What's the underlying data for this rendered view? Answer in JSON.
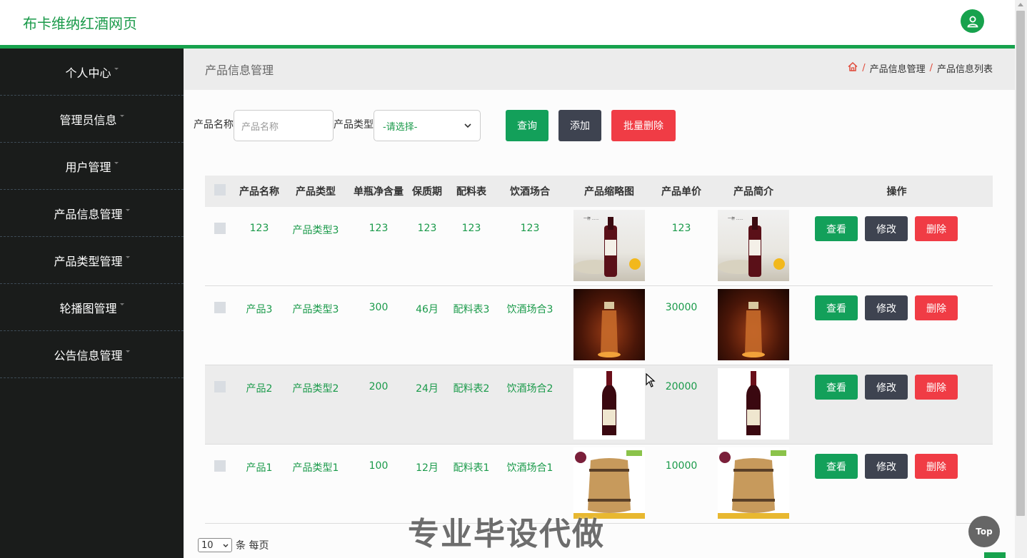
{
  "app": {
    "title": "布卡维纳红酒网页"
  },
  "sidebar": {
    "items": [
      {
        "label": "个人中心"
      },
      {
        "label": "管理员信息"
      },
      {
        "label": "用户管理"
      },
      {
        "label": "产品信息管理"
      },
      {
        "label": "产品类型管理"
      },
      {
        "label": "轮播图管理"
      },
      {
        "label": "公告信息管理"
      }
    ]
  },
  "page": {
    "title": "产品信息管理",
    "breadcrumb": [
      "产品信息管理",
      "产品信息列表"
    ]
  },
  "search": {
    "name_label": "产品名称",
    "name_placeholder": "产品名称",
    "type_label": "产品类型",
    "type_selected": "-请选择-",
    "query_label": "查询",
    "add_label": "添加",
    "batch_delete_label": "批量删除"
  },
  "table": {
    "headers": [
      "产品名称",
      "产品类型",
      "单瓶净含量",
      "保质期",
      "配料表",
      "饮酒场合",
      "产品缩略图",
      "产品单价",
      "产品简介",
      "操作"
    ],
    "rows": [
      {
        "name": "123",
        "type": "产品类型3",
        "volume": "123",
        "shelf": "123",
        "ingredients": "123",
        "occasion": "123",
        "price": "123"
      },
      {
        "name": "产品3",
        "type": "产品类型3",
        "volume": "300",
        "shelf": "46月",
        "ingredients": "配料表3",
        "occasion": "饮酒场合3",
        "price": "30000"
      },
      {
        "name": "产品2",
        "type": "产品类型2",
        "volume": "200",
        "shelf": "24月",
        "ingredients": "配料表2",
        "occasion": "饮酒场合2",
        "price": "20000"
      },
      {
        "name": "产品1",
        "type": "产品类型1",
        "volume": "100",
        "shelf": "12月",
        "ingredients": "配料表1",
        "occasion": "饮酒场合1",
        "price": "10000"
      }
    ],
    "actions": {
      "view": "查看",
      "edit": "修改",
      "delete": "删除"
    }
  },
  "pager": {
    "page_size": "10",
    "suffix": "条 每页"
  },
  "overlay": {
    "watermark": "专业毕设代做",
    "top_label": "Top"
  },
  "colors": {
    "brand": "#17a24d",
    "dark": "#3e4350",
    "danger": "#f03c45",
    "sidebar": "#1a1c1b"
  }
}
